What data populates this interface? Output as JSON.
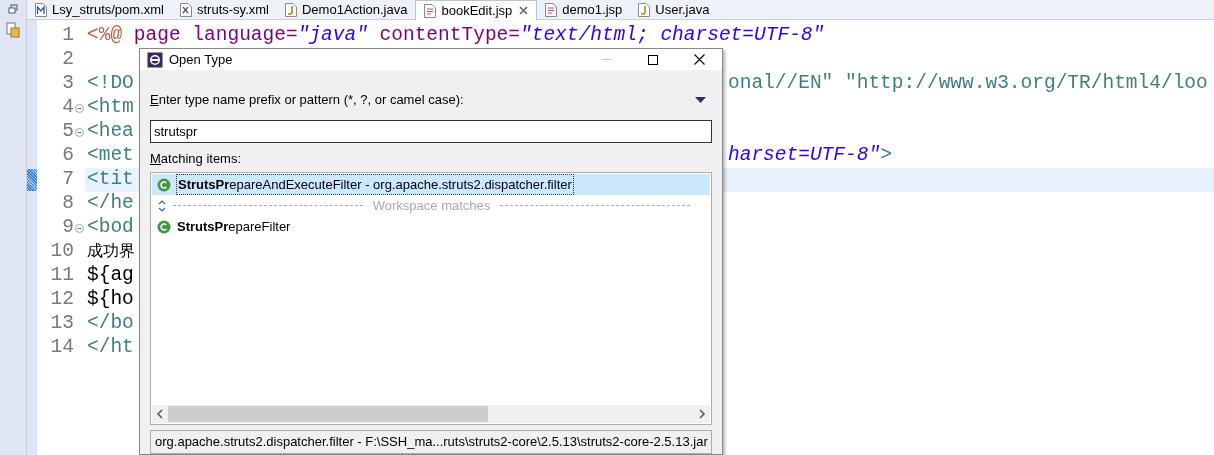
{
  "tabs": [
    {
      "label": "Lsy_struts/pom.xml",
      "kind": "maven",
      "selected": false,
      "closable": false
    },
    {
      "label": "struts-sy.xml",
      "kind": "xml",
      "selected": false,
      "closable": false
    },
    {
      "label": "Demo1Action.java",
      "kind": "java",
      "selected": false,
      "closable": false
    },
    {
      "label": "bookEdit.jsp",
      "kind": "jsp",
      "selected": true,
      "closable": true
    },
    {
      "label": "demo1.jsp",
      "kind": "jsp",
      "selected": false,
      "closable": false
    },
    {
      "label": "User.java",
      "kind": "java",
      "selected": false,
      "closable": false
    }
  ],
  "editor": {
    "lines": [
      {
        "number": "1",
        "foldable": false,
        "current": false,
        "left": [
          {
            "text": "<%@",
            "kind": "directive"
          },
          {
            "text": " page language=",
            "kind": "attr"
          },
          {
            "text": "\"java\"",
            "kind": "value"
          },
          {
            "text": " contentType=",
            "kind": "attr"
          },
          {
            "text": "\"text/html; charset=UTF-8\"",
            "kind": "value"
          }
        ]
      },
      {
        "number": "2",
        "foldable": false,
        "current": false
      },
      {
        "number": "3",
        "foldable": false,
        "current": false,
        "left": [
          {
            "text": "<!DO",
            "kind": "tag"
          }
        ],
        "right": [
          {
            "text": "onal//EN\" \"http://www.w3.org/TR/html4/loo",
            "kind": "tag"
          }
        ]
      },
      {
        "number": "4",
        "foldable": true,
        "current": false,
        "left": [
          {
            "text": "<htm",
            "kind": "tag"
          }
        ]
      },
      {
        "number": "5",
        "foldable": true,
        "current": false,
        "left": [
          {
            "text": "<hea",
            "kind": "tag"
          }
        ]
      },
      {
        "number": "6",
        "foldable": false,
        "current": false,
        "left": [
          {
            "text": "<met",
            "kind": "tag"
          }
        ],
        "right": [
          {
            "text": "harset=UTF-8\"",
            "kind": "value"
          },
          {
            "text": ">",
            "kind": "tag"
          }
        ]
      },
      {
        "number": "7",
        "foldable": false,
        "current": true,
        "left": [
          {
            "text": "<tit",
            "kind": "tag"
          }
        ]
      },
      {
        "number": "8",
        "foldable": false,
        "current": false,
        "left": [
          {
            "text": "</he",
            "kind": "tag"
          }
        ]
      },
      {
        "number": "9",
        "foldable": true,
        "current": false,
        "left": [
          {
            "text": "<bod",
            "kind": "tag"
          }
        ]
      },
      {
        "number": "10",
        "foldable": false,
        "current": false,
        "left": [
          {
            "text": "成功界",
            "kind": "cjk"
          }
        ]
      },
      {
        "number": "11",
        "foldable": false,
        "current": false,
        "left": [
          {
            "text": "${ag",
            "kind": "text"
          }
        ]
      },
      {
        "number": "12",
        "foldable": false,
        "current": false,
        "left": [
          {
            "text": "${ho",
            "kind": "text"
          }
        ]
      },
      {
        "number": "13",
        "foldable": false,
        "current": false,
        "left": [
          {
            "text": "</bo",
            "kind": "tag"
          }
        ]
      },
      {
        "number": "14",
        "foldable": false,
        "current": false,
        "left": [
          {
            "text": "</ht",
            "kind": "tag"
          }
        ]
      }
    ]
  },
  "dialog": {
    "title": "Open Type",
    "pattern_label": "Enter type name prefix or pattern (*, ?, or camel case):",
    "pattern_value": "strutspr",
    "list_label": "Matching items:",
    "items": [
      {
        "kind": "class",
        "text": "**StrutsPr**epareAndExecuteFilter - org.apache.struts2.dispatcher.filter",
        "selected": true
      },
      {
        "kind": "separator",
        "text": "Workspace matches"
      },
      {
        "kind": "class",
        "text": "**StrutsPr**epareFilter",
        "selected": false
      }
    ],
    "details": "org.apache.struts2.dispatcher.filter - F:\\SSH_ma...ruts\\struts2-core\\2.5.13\\struts2-core-2.5.13.jar"
  }
}
